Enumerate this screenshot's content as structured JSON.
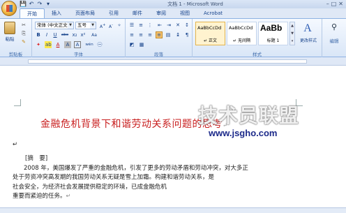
{
  "window": {
    "title": "文档 1 - Microsoft Word",
    "controls": [
      "–",
      "□",
      "✕"
    ]
  },
  "quick_access": [
    "💾",
    "↶",
    "↷",
    "▾"
  ],
  "tabs": [
    {
      "label": "开始"
    },
    {
      "label": "插入"
    },
    {
      "label": "页面布局"
    },
    {
      "label": "引用"
    },
    {
      "label": "邮件"
    },
    {
      "label": "审阅"
    },
    {
      "label": "视图"
    },
    {
      "label": "Acrobat"
    }
  ],
  "ribbon": {
    "clipboard": {
      "label": "剪贴板",
      "paste": "粘贴"
    },
    "font": {
      "label": "字体",
      "family": "宋体 (中文正文)",
      "size": "五号",
      "bold": "B",
      "italic": "I",
      "underline": "U",
      "strike": "abe",
      "sub": "x₂",
      "sup": "x²",
      "color_a": "A",
      "font_a": "A",
      "wen": "wén",
      "aa": "Aa"
    },
    "paragraph": {
      "label": "段落"
    },
    "styles": {
      "label": "样式",
      "items": [
        {
          "sample": "AaBbCcDd",
          "name": "↵ 正文"
        },
        {
          "sample": "AaBbCcDd",
          "name": "↵ 无间隔"
        },
        {
          "sample": "AaBb",
          "name": "标题 1"
        }
      ],
      "change": "更改样式"
    },
    "editing": {
      "label": "编辑"
    }
  },
  "document": {
    "title": "金融危机背景下和谐劳动关系问题的思考",
    "para_mark": "↵",
    "abstract_label": "[摘　要]",
    "lines": [
      "2008 年，美国爆发了严重的金融危机，引发了更多的劳动矛盾和劳动冲突，对大多正",
      "处于劳资冲突高发期的我国劳动关系无疑是雪上加霜。构建和谐劳动关系，是",
      "社会安全，为经济社会发展提供稳定的环境，已成金融危机",
      "重要而紧迫的任务。"
    ]
  },
  "watermark": {
    "text": "技术员联盟",
    "url": "www.jsgho.com"
  }
}
